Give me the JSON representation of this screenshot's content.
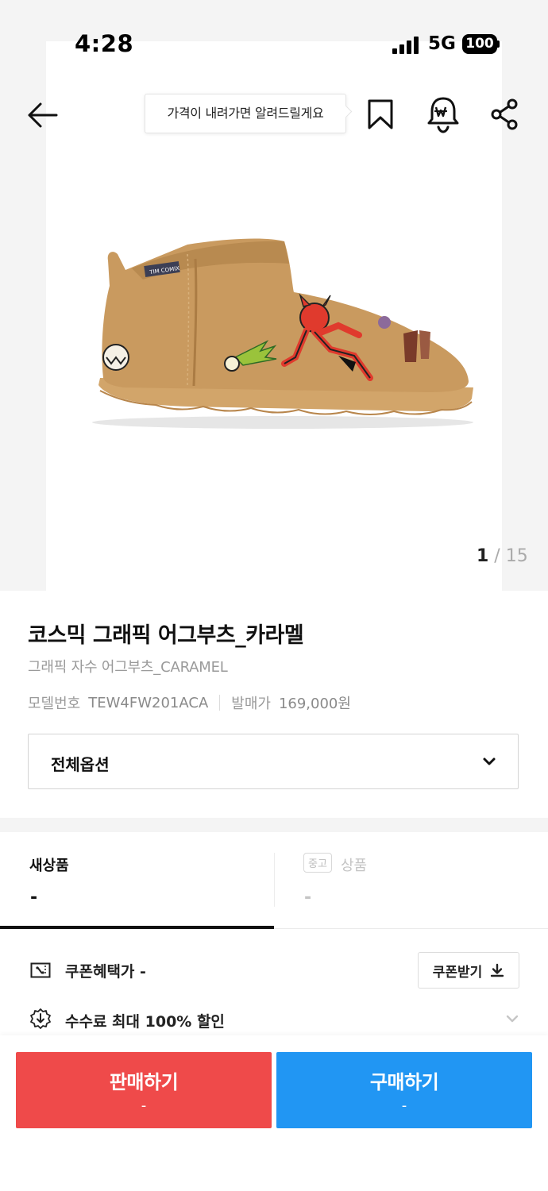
{
  "status_bar": {
    "time": "4:28",
    "network": "5G",
    "battery": "100"
  },
  "header": {
    "price_alert_tooltip": "가격이 내려가면 알려드릴게요"
  },
  "gallery": {
    "current": "1",
    "separator": " / ",
    "total": "15"
  },
  "product": {
    "title": "코스믹 그래픽 어그부츠_카라멜",
    "subtitle": "그래픽 자수 어그부츠_CARAMEL",
    "model_label": "모델번호",
    "model_value": "TEW4FW201ACA",
    "release_label": "발매가",
    "release_value": "169,000원"
  },
  "options": {
    "selected": "전체옵션"
  },
  "tabs": {
    "new": {
      "label": "새상품",
      "value": "-"
    },
    "used": {
      "badge": "중고",
      "label": "상품",
      "value": "-"
    }
  },
  "coupon": {
    "label": "쿠폰혜택가 -",
    "button": "쿠폰받기"
  },
  "fee": {
    "label": "수수료 최대 100% 할인"
  },
  "actions": {
    "sell": {
      "label": "판매하기",
      "sub": "-"
    },
    "buy": {
      "label": "구매하기",
      "sub": "-"
    }
  },
  "colors": {
    "sell": "#ef4a4a",
    "buy": "#2196f3",
    "text": "#222222"
  },
  "icons": [
    "back-arrow-icon",
    "bookmark-icon",
    "price-alert-bell-icon",
    "share-icon",
    "chevron-down-icon",
    "coupon-icon",
    "download-icon",
    "fee-discount-icon"
  ]
}
